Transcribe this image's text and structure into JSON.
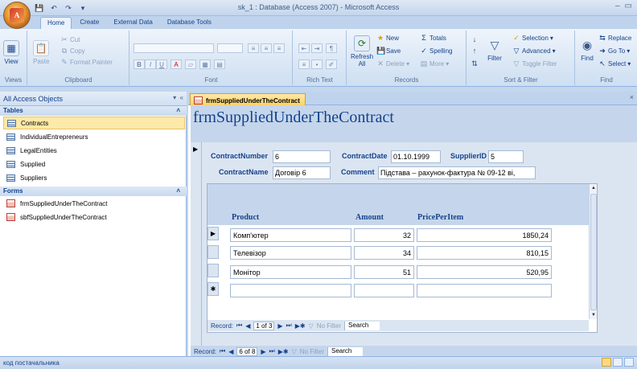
{
  "window": {
    "title": "sk_1 : Database (Access 2007) - Microsoft Access"
  },
  "ribbon": {
    "tabs": [
      "Home",
      "Create",
      "External Data",
      "Database Tools"
    ],
    "groups": {
      "views": {
        "label": "Views",
        "view": "View"
      },
      "clipboard": {
        "label": "Clipboard",
        "paste": "Paste",
        "cut": "Cut",
        "copy": "Copy",
        "format_painter": "Format Painter"
      },
      "font": {
        "label": "Font"
      },
      "rich_text": {
        "label": "Rich Text"
      },
      "records": {
        "label": "Records",
        "refresh": "Refresh All",
        "new": "New",
        "save": "Save",
        "delete": "Delete",
        "totals": "Totals",
        "spelling": "Spelling",
        "more": "More"
      },
      "sort_filter": {
        "label": "Sort & Filter",
        "filter": "Filter",
        "selection": "Selection",
        "advanced": "Advanced",
        "toggle_filter": "Toggle Filter"
      },
      "find": {
        "label": "Find",
        "find": "Find",
        "replace": "Replace",
        "goto": "Go To",
        "select": "Select"
      }
    }
  },
  "nav": {
    "header": "All Access Objects",
    "tables_label": "Tables",
    "tables": [
      "Contracts",
      "IndividualEntrepreneurs",
      "LegalEntities",
      "Supplied",
      "Suppliers"
    ],
    "forms_label": "Forms",
    "forms": [
      "frmSuppliedUnderTheContract",
      "sbfSuppliedUnderTheContract"
    ]
  },
  "document": {
    "tab_label": "frmSuppliedUnderTheContract",
    "form_title": "frmSuppliedUnderTheContract",
    "fields": {
      "contract_number_label": "ContractNumber",
      "contract_number": "6",
      "contract_date_label": "ContractDate",
      "contract_date": "01.10.1999",
      "supplier_id_label": "SupplierID",
      "supplier_id": "5",
      "contract_name_label": "ContractName",
      "contract_name": "Договір 6",
      "comment_label": "Comment",
      "comment": "Підстава – рахунок-фактура № 09-12 ві,"
    },
    "subform": {
      "columns": [
        "Product",
        "Amount",
        "PricePerItem"
      ],
      "rows": [
        {
          "product": "Комп'ютер",
          "amount": "32",
          "price": "1850,24"
        },
        {
          "product": "Телевізор",
          "amount": "34",
          "price": "810,15"
        },
        {
          "product": "Монітор",
          "amount": "51",
          "price": "520,95"
        }
      ],
      "nav": {
        "record_label": "Record:",
        "position": "1 of 3",
        "no_filter": "No Filter",
        "search": "Search"
      }
    },
    "nav": {
      "record_label": "Record:",
      "position": "6 of 8",
      "no_filter": "No Filter",
      "search": "Search"
    }
  },
  "status": {
    "text": "код постачальника"
  }
}
